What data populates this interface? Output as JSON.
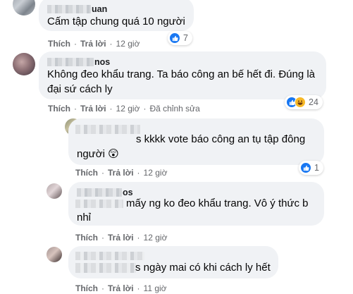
{
  "comments": [
    {
      "author_suffix": "uan",
      "text_lines": [
        "Cấm tập chung quá 10 người"
      ],
      "actions": {
        "like": "Thích",
        "reply": "Trả lời",
        "time": "12 giờ",
        "edited": ""
      },
      "reactions": {
        "types": [
          "like-icon"
        ],
        "count": "7"
      }
    },
    {
      "author_suffix": "nos",
      "text_lines": [
        "Không đeo khẩu trang. Ta báo công an bế hết đi. Đúng là",
        "đại sứ cách ly"
      ],
      "actions": {
        "like": "Thích",
        "reply": "Trả lời",
        "time": "12 giờ",
        "edited": "Đã chỉnh sửa"
      },
      "reactions": {
        "types": [
          "like-icon",
          "haha-icon"
        ],
        "count": "24"
      }
    },
    {
      "author_suffix": "",
      "text_lines": [
        "s kkkk vote báo công an tụ tập đông",
        "người 😲"
      ],
      "actions": {
        "like": "Thích",
        "reply": "Trả lời",
        "time": "12 giờ",
        "edited": ""
      },
      "reactions": {
        "types": [
          "like-icon"
        ],
        "count": "1"
      }
    },
    {
      "author_suffix": "os",
      "text_lines": [
        "mấy ng ko đeo khẩu trang. Vô ý thức b",
        "nhỉ"
      ],
      "actions": {
        "like": "Thích",
        "reply": "Trả lời",
        "time": "12 giờ",
        "edited": ""
      },
      "reactions": {
        "types": [],
        "count": ""
      }
    },
    {
      "author_suffix": "",
      "text_lines": [
        "s ngày mai có khi cách ly hết"
      ],
      "actions": {
        "like": "Thích",
        "reply": "Trả lời",
        "time": "11 giờ",
        "edited": ""
      },
      "reactions": {
        "types": [],
        "count": ""
      }
    }
  ],
  "colors": {
    "bubble": "#f0f2f5",
    "like_blue": "#1877f2",
    "haha_yellow": "#f7b928",
    "meta_gray": "#65676b"
  }
}
